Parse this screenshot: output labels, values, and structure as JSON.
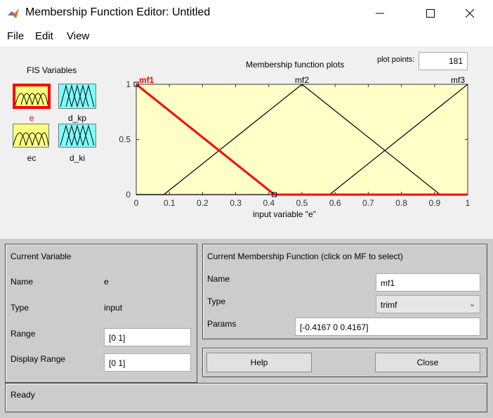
{
  "window": {
    "title": "Membership Function Editor: Untitled",
    "icon": "matlab-icon",
    "controls": [
      "minimize-icon",
      "maximize-icon",
      "close-icon"
    ]
  },
  "menu": {
    "file": "File",
    "edit": "Edit",
    "view": "View"
  },
  "fis": {
    "label": "FIS Variables",
    "variables": [
      {
        "name": "e",
        "kind": "input",
        "selected": true
      },
      {
        "name": "d_kp",
        "kind": "output",
        "selected": false
      },
      {
        "name": "ec",
        "kind": "input",
        "selected": false
      },
      {
        "name": "d_ki",
        "kind": "output",
        "selected": false
      }
    ]
  },
  "plot": {
    "title": "Membership function plots",
    "points_label": "plot points:",
    "points_value": "181",
    "selected_color": "#ff0000"
  },
  "chart_data": {
    "type": "line",
    "xlabel": "input variable \"e\"",
    "ylabel": "",
    "xlim": [
      0,
      1
    ],
    "ylim": [
      0,
      1
    ],
    "xticks": [
      "0",
      "0.1",
      "0.2",
      "0.3",
      "0.4",
      "0.5",
      "0.6",
      "0.7",
      "0.8",
      "0.9",
      "1"
    ],
    "yticks": [
      "0",
      "0.5",
      "1"
    ],
    "series": [
      {
        "name": "mf1",
        "x": [
          -0.4167,
          0,
          0.4167,
          1
        ],
        "y": [
          0,
          1,
          0,
          0
        ],
        "selected": true
      },
      {
        "name": "mf2",
        "x": [
          0,
          0.0833,
          0.5,
          0.9167,
          1
        ],
        "y": [
          0,
          0,
          1,
          0,
          0
        ],
        "selected": false
      },
      {
        "name": "mf3",
        "x": [
          0,
          0.5833,
          1,
          1.4167
        ],
        "y": [
          0,
          0,
          1,
          0
        ],
        "selected": false
      }
    ]
  },
  "current_variable": {
    "title": "Current Variable",
    "name_label": "Name",
    "name_value": "e",
    "type_label": "Type",
    "type_value": "input",
    "range_label": "Range",
    "range_value": "[0 1]",
    "display_range_label": "Display Range",
    "display_range_value": "[0 1]"
  },
  "current_mf": {
    "title": "Current Membership Function (click on MF to select)",
    "name_label": "Name",
    "name_value": "mf1",
    "type_label": "Type",
    "type_value": "trimf",
    "params_label": "Params",
    "params_value": "[-0.4167 0 0.4167]"
  },
  "buttons": {
    "help": "Help",
    "close": "Close"
  },
  "status": {
    "text": "Ready"
  }
}
